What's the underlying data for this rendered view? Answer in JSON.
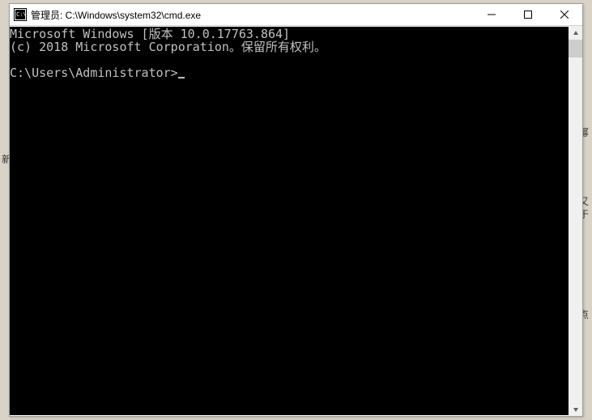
{
  "window": {
    "title": "管理员: C:\\Windows\\system32\\cmd.exe"
  },
  "console": {
    "line1": "Microsoft Windows [版本 10.0.17763.864]",
    "line2": "(c) 2018 Microsoft Corporation。保留所有权利。",
    "blank": "",
    "prompt": "C:\\Users\\Administrator>"
  },
  "bg": {
    "left": "新",
    "r1": "幂",
    "r2": "又",
    "r3": "于",
    "r4": "点"
  }
}
